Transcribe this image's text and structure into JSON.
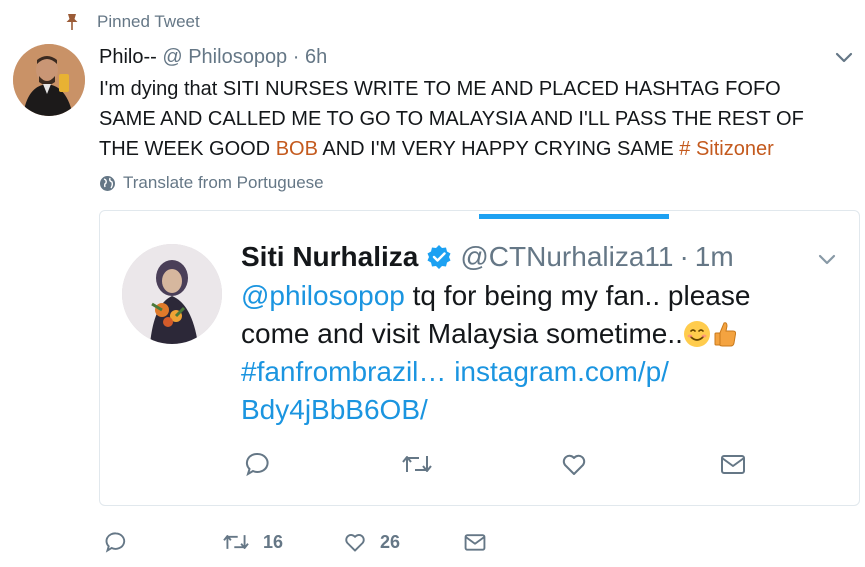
{
  "pinned": {
    "label": "Pinned Tweet"
  },
  "tweet": {
    "display_name": "Philo--",
    "handle": "@ Philosopop",
    "separator": "·",
    "time": "6h",
    "text_part1": "I'm dying that SITI NURSES WRITE TO ME AND PLACED HASHTAG FOFO SAME AND CALLED ME TO GO TO MALAYSIA AND I'LL PASS THE REST OF THE WEEK GOOD ",
    "text_highlight1": "BOB",
    "text_part2": " AND I'M VERY HAPPY CRYING SAME ",
    "text_highlight2": "# Sitizoner",
    "translate_label": "Translate from Portuguese",
    "retweet_count": "16",
    "like_count": "26"
  },
  "quoted": {
    "display_name": "Siti Nurhaliza",
    "handle": "@CTNurhaliza11",
    "separator": "·",
    "time": "1m",
    "mention": "@philosopop",
    "text": " tq for being my fan.. please come and visit Malaysia sometime..",
    "hashtag": "#fanfrombrazil…",
    "link_part1": "instagram.com/p/",
    "link_part2": "Bdy4jBbB6OB/"
  },
  "icons": {
    "pinned": "pin-icon",
    "globe": "globe-icon",
    "caret": "chevron-down-icon",
    "verified": "verified-badge-icon",
    "emoji1": "smiling-face-emoji",
    "emoji2": "thumbs-up-emoji",
    "reply": "reply-icon",
    "retweet": "retweet-icon",
    "like": "heart-icon",
    "dm": "envelope-icon"
  },
  "colors": {
    "accent": "#1da1f2",
    "link": "#1b95e0",
    "muted": "#657786",
    "highlight": "#c45a1e",
    "border": "#e1e8ed"
  }
}
